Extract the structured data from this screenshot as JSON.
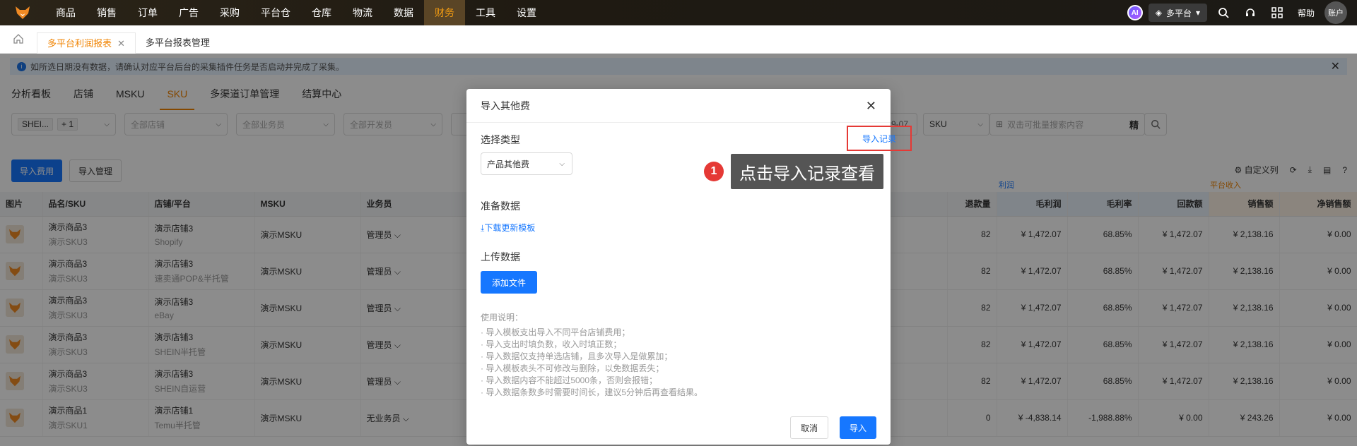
{
  "nav": {
    "items": [
      "商品",
      "销售",
      "订单",
      "广告",
      "采购",
      "平台仓",
      "仓库",
      "物流",
      "数据",
      "财务",
      "工具",
      "设置"
    ],
    "active": "财务"
  },
  "topright": {
    "ai": "AI",
    "platform": "多平台",
    "help": "帮助",
    "account": "账户"
  },
  "page_tabs": [
    {
      "label": "多平台利润报表",
      "active": true
    },
    {
      "label": "多平台报表管理",
      "active": false
    }
  ],
  "alert": "如所选日期没有数据，请确认对应平台后台的采集插件任务是否启动并完成了采集。",
  "sub_tabs": [
    "分析看板",
    "店铺",
    "MSKU",
    "SKU",
    "多渠道订单管理",
    "结算中心"
  ],
  "active_sub_tab": "SKU",
  "filters": {
    "site_tag": "SHEI...",
    "plus": "+ 1",
    "shop": "全部店铺",
    "salesman": "全部业务员",
    "developer": "全部开发员",
    "date_end": "-09-07",
    "search_type": "SKU",
    "search_placeholder": "双击可批量搜索内容",
    "precise": "精"
  },
  "actions": {
    "import_fee": "导入费用",
    "import_manage": "导入管理",
    "custom_columns": "自定义列"
  },
  "groups": {
    "profit": "利润",
    "platform_income": "平台收入"
  },
  "table": {
    "headers": [
      "图片",
      "品名/SKU",
      "店铺/平台",
      "MSKU",
      "业务员",
      "退款量",
      "毛利润",
      "毛利率",
      "回款额",
      "销售额",
      "净销售额"
    ],
    "thumb_text": "赛狐",
    "rows": [
      {
        "name": "演示商品3",
        "sku": "演示SKU3",
        "shop": "演示店铺3",
        "platform": "Shopify",
        "msku": "演示MSKU",
        "salesman": "管理员",
        "refund": "82",
        "profit": "¥ 1,472.07",
        "margin": "68.85%",
        "payback": "¥ 1,472.07",
        "sales": "¥ 2,138.16",
        "net_sales": "¥ 0.00"
      },
      {
        "name": "演示商品3",
        "sku": "演示SKU3",
        "shop": "演示店铺3",
        "platform": "速卖通POP&半托管",
        "msku": "演示MSKU",
        "salesman": "管理员",
        "refund": "82",
        "profit": "¥ 1,472.07",
        "margin": "68.85%",
        "payback": "¥ 1,472.07",
        "sales": "¥ 2,138.16",
        "net_sales": "¥ 0.00"
      },
      {
        "name": "演示商品3",
        "sku": "演示SKU3",
        "shop": "演示店铺3",
        "platform": "eBay",
        "msku": "演示MSKU",
        "salesman": "管理员",
        "refund": "82",
        "profit": "¥ 1,472.07",
        "margin": "68.85%",
        "payback": "¥ 1,472.07",
        "sales": "¥ 2,138.16",
        "net_sales": "¥ 0.00"
      },
      {
        "name": "演示商品3",
        "sku": "演示SKU3",
        "shop": "演示店铺3",
        "platform": "SHEIN半托管",
        "msku": "演示MSKU",
        "salesman": "管理员",
        "refund": "82",
        "profit": "¥ 1,472.07",
        "margin": "68.85%",
        "payback": "¥ 1,472.07",
        "sales": "¥ 2,138.16",
        "net_sales": "¥ 0.00"
      },
      {
        "name": "演示商品3",
        "sku": "演示SKU3",
        "shop": "演示店铺3",
        "platform": "SHEIN自运营",
        "msku": "演示MSKU",
        "salesman": "管理员",
        "refund": "82",
        "profit": "¥ 1,472.07",
        "margin": "68.85%",
        "payback": "¥ 1,472.07",
        "sales": "¥ 2,138.16",
        "net_sales": "¥ 0.00"
      },
      {
        "name": "演示商品1",
        "sku": "演示SKU1",
        "shop": "演示店铺1",
        "platform": "Temu半托管",
        "msku": "演示MSKU",
        "salesman": "无业务员",
        "refund": "0",
        "profit": "¥ -4,838.14",
        "margin": "-1,988.88%",
        "payback": "¥ 0.00",
        "sales": "¥ 243.26",
        "net_sales": "¥ 0.00"
      }
    ]
  },
  "modal": {
    "title": "导入其他费",
    "select_type_label": "选择类型",
    "type_value": "产品其他费",
    "import_record": "导入记录",
    "prepare_label": "准备数据",
    "download_template": "下载更新模板",
    "upload_label": "上传数据",
    "add_file": "添加文件",
    "notes_title": "使用说明：",
    "notes": [
      "· 导入模板支出导入不同平台店铺费用；",
      "· 导入支出时填负数，收入时填正数；",
      "· 导入数据仅支持单选店铺，且多次导入是做累加；",
      "· 导入模板表头不可修改与删除，以免数据丢失；",
      "· 导入数据内容不能超过5000条，否则会报错；",
      "· 导入数据条数多时需要时间长，建议5分钟后再查看结果。"
    ],
    "cancel": "取消",
    "import": "导入"
  },
  "callout": {
    "number": "1",
    "text": "点击导入记录查看"
  }
}
